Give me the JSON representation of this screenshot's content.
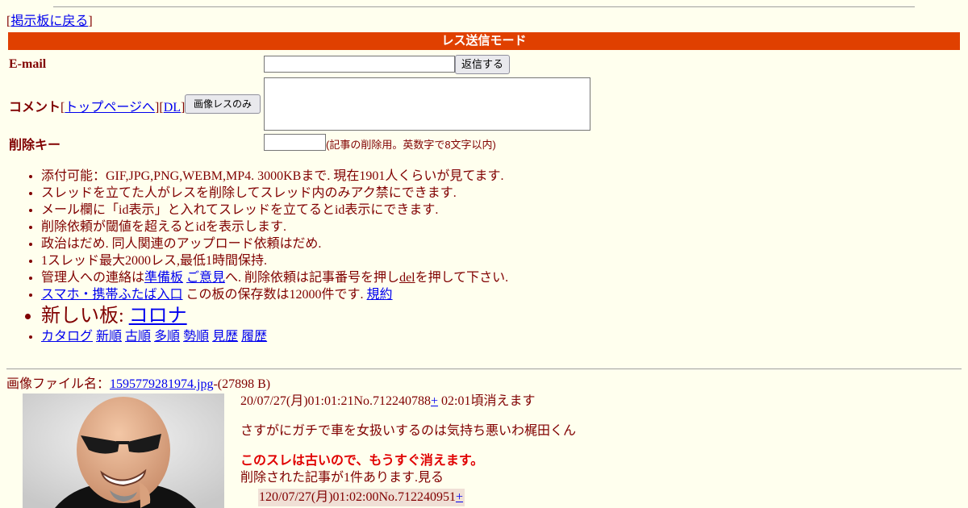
{
  "nav": {
    "back_prefix": "[",
    "back_link": "掲示板に戻る",
    "back_suffix": "]"
  },
  "form": {
    "mode_title": "レス送信モード",
    "email_label": "E-mail",
    "email_value": "",
    "send_button": "返信する",
    "comment_label": "コメント",
    "comment_open": "[",
    "top_page_link": "トップページへ",
    "comment_mid": "][",
    "dl_link": "DL",
    "comment_close": "]",
    "image_only_button": "画像レスのみ",
    "comment_value": "",
    "delete_key_label": "削除キー",
    "delete_key_value": "",
    "delete_key_note": "(記事の削除用。英数字で8文字以内)"
  },
  "notes": {
    "n1": "添付可能：GIF,JPG,PNG,WEBM,MP4. 3000KBまで. 現在1901人くらいが見てます.",
    "n2": "スレッドを立てた人がレスを削除してスレッド内のみアク禁にできます.",
    "n3": "メール欄に「id表示」と入れてスレッドを立てるとid表示にできます.",
    "n4": "削除依頼が閾値を超えるとidを表示します.",
    "n5": "政治はだめ. 同人関連のアップロード依頼はだめ.",
    "n6": "1スレッド最大2000レス,最低1時間保持.",
    "n7_prefix": "管理人への連絡は",
    "n7_link1": "準備板",
    "n7_link2": "ご意見",
    "n7_mid": "へ. 削除依頼は記事番号を押し",
    "n7_del": "del",
    "n7_suffix": "を押して下さい.",
    "n8_link": "スマホ・携帯ふたば入口",
    "n8_text": " この板の保存数は12000件です. ",
    "n8_link2": "規約",
    "n9_text": "新しい板: ",
    "n9_link": "コロナ",
    "catalog": [
      "カタログ",
      "新順",
      "古順",
      "多順",
      "勢順",
      "見歴",
      "履歴"
    ]
  },
  "thread": {
    "file_label": "画像ファイル名：",
    "file_name": "1595779281974.jpg",
    "file_size": "-(27898 B)",
    "post_meta": "20/07/27(月)01:01:21No.712240788",
    "post_plus": "+",
    "post_expire": " 02:01頃消えます",
    "post_body": "さすがにガチで車を女扱いするのは気持ち悪いわ梶田くん",
    "old_warning": "このスレは古いので、もうすぐ消えます。",
    "deleted_notice": "削除された記事が1件あります.見る",
    "reply_meta": "120/07/27(月)01:02:00No.712240951",
    "reply_plus": "+"
  }
}
